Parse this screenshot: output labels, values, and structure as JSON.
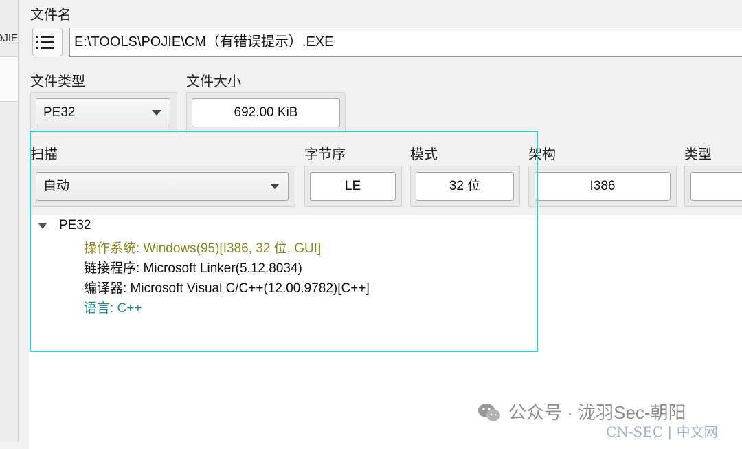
{
  "left_strip": {
    "fragment": "OJIE"
  },
  "file_name": {
    "label": "文件名",
    "value": "E:\\TOOLS\\POJIE\\CM（有错误提示）.EXE"
  },
  "file_type": {
    "label": "文件类型",
    "value": "PE32"
  },
  "file_size": {
    "label": "文件大小",
    "value": "692.00 KiB"
  },
  "scan": {
    "label": "扫描",
    "value": "自动"
  },
  "endianness": {
    "label": "字节序",
    "value": "LE"
  },
  "mode": {
    "label": "模式",
    "value": "32 位"
  },
  "arch": {
    "label": "架构",
    "value": "I386"
  },
  "type": {
    "label": "类型",
    "value": ""
  },
  "results": {
    "root": "PE32",
    "items": [
      {
        "text": "操作系统: Windows(95)[I386, 32 位, GUI]",
        "color": "#8a8a1e"
      },
      {
        "text": "链接程序: Microsoft Linker(5.12.8034)",
        "color": "#111111"
      },
      {
        "text": "编译器: Microsoft Visual C/C++(12.00.9782)[C++]",
        "color": "#111111"
      },
      {
        "text": "语言: C++",
        "color": "#1e8e8e"
      }
    ]
  },
  "highlight_color": "#35cbc4",
  "watermark": {
    "icon": "wechat-icon",
    "text": "公众号 · 泷羽Sec-朝阳"
  },
  "footer_mark": "CN-SEC | 中文网"
}
